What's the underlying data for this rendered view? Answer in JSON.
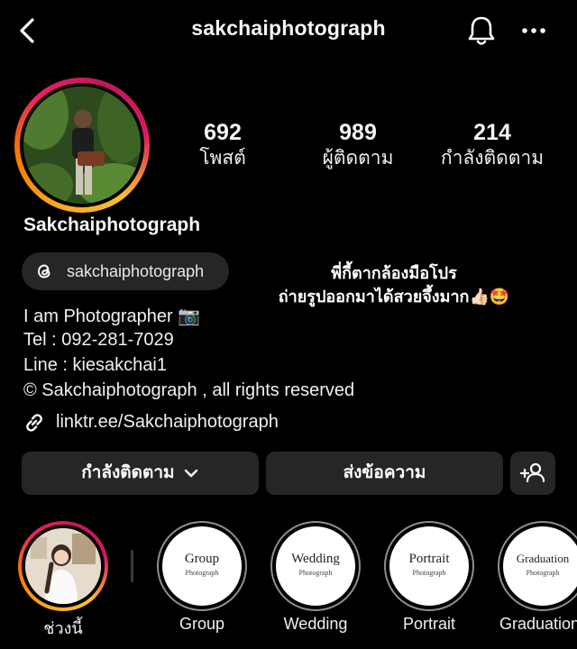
{
  "header": {
    "username": "sakchaiphotograph",
    "back_icon": "back-chevron-icon",
    "bell_icon": "bell-icon",
    "more_icon": "more-dots-icon"
  },
  "profile": {
    "display_name": "Sakchaiphotograph",
    "stats": [
      {
        "value": "692",
        "label": "โพสต์"
      },
      {
        "value": "989",
        "label": "ผู้ติดตาม"
      },
      {
        "value": "214",
        "label": "กำลังติดตาม"
      }
    ],
    "threads_handle": "sakchaiphotograph",
    "note_line1": "พี่กี้ตากล้องมือโปร",
    "note_line2": "ถ่ายรูปออกมาได้สวยจึ้งมาก👍🏻🤩",
    "bio": [
      "I am Photographer 📷",
      "Tel : 092-281-7029",
      "Line : kiesakchai1",
      "© Sakchaiphotograph , all rights reserved"
    ],
    "link": "linktr.ee/Sakchaiphotograph"
  },
  "actions": {
    "following_label": "กำลังติดตาม",
    "message_label": "ส่งข้อความ"
  },
  "highlights": [
    {
      "label": "ช่วงนี้",
      "cover_title": "",
      "cover_sub": ""
    },
    {
      "label": "Group",
      "cover_title": "Group",
      "cover_sub": "Photograph"
    },
    {
      "label": "Wedding",
      "cover_title": "Wedding",
      "cover_sub": "Photograph"
    },
    {
      "label": "Portrait",
      "cover_title": "Portrait",
      "cover_sub": "Photograph"
    },
    {
      "label": "Graduation",
      "cover_title": "Graduation",
      "cover_sub": "Photograph"
    }
  ],
  "colors": {
    "background": "#000000",
    "button_bg": "#262626",
    "ring_gradient": [
      "#f9a825",
      "#e91e63",
      "#c2185b"
    ]
  }
}
